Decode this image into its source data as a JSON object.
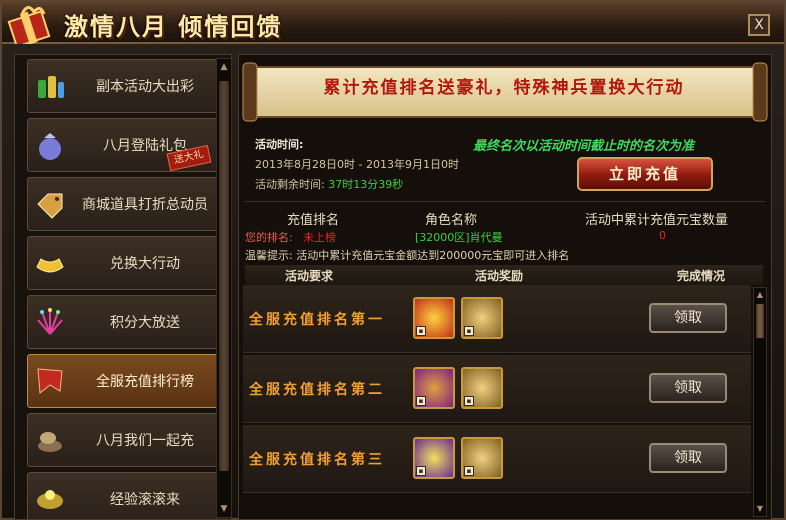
{
  "window": {
    "title": "激情八月 倾情回馈",
    "close_label": "X"
  },
  "sidebar": {
    "items": [
      {
        "label": "副本活动大出彩",
        "icon": "potion-bottles-icon"
      },
      {
        "label": "八月登陆礼包",
        "icon": "gift-bag-icon",
        "badge": "送大礼"
      },
      {
        "label": "商城道具打折总动员",
        "icon": "discount-tag-icon"
      },
      {
        "label": "兑换大行动",
        "icon": "gold-ingot-icon"
      },
      {
        "label": "积分大放送",
        "icon": "fireworks-icon"
      },
      {
        "label": "全服充值排行榜",
        "icon": "red-banner-icon",
        "active": true
      },
      {
        "label": "八月我们一起充",
        "icon": "coin-pile-icon"
      },
      {
        "label": "经验滚滚来",
        "icon": "exp-orb-icon"
      }
    ]
  },
  "banner": {
    "text": "累计充值排名送豪礼，特殊神兵置换大行动"
  },
  "activity": {
    "time_header": "活动时间:",
    "dates": "2013年8月28日0时 - 2013年9月1日0时",
    "remaining_label": "活动剩余时间:",
    "remaining_value": "37时13分39秒",
    "notice": "最终名次以活动时间截止时的名次为准",
    "recharge_button": "立即充值"
  },
  "ranking": {
    "headers": [
      "充值排名",
      "角色名称",
      "活动中累计充值元宝数量"
    ],
    "my_rank_label": "您的排名:",
    "my_rank_value": "未上榜",
    "role_name": "[32000区]肖代曼",
    "amount": "0",
    "tip": "温馨提示: 活动中累计充值元宝金额达到200000元宝即可进入排名"
  },
  "table": {
    "headers": [
      "活动要求",
      "活动奖励",
      "完成情况"
    ],
    "rows": [
      {
        "requirement": "全服充值排名第一",
        "rewards": [
          "gold-chest-icon",
          "sword-scroll-icon"
        ],
        "status": "领取"
      },
      {
        "requirement": "全服充值排名第二",
        "rewards": [
          "treasure-bag-icon",
          "sword-scroll-icon"
        ],
        "status": "领取"
      },
      {
        "requirement": "全服充值排名第三",
        "rewards": [
          "gem-bag-icon",
          "sword-scroll-icon"
        ],
        "status": "领取"
      }
    ]
  },
  "colors": {
    "accent_red": "#b0180c",
    "notice_green": "#3fd85a",
    "rank_orange": "#f0a030",
    "timer_green": "#39d13a"
  }
}
